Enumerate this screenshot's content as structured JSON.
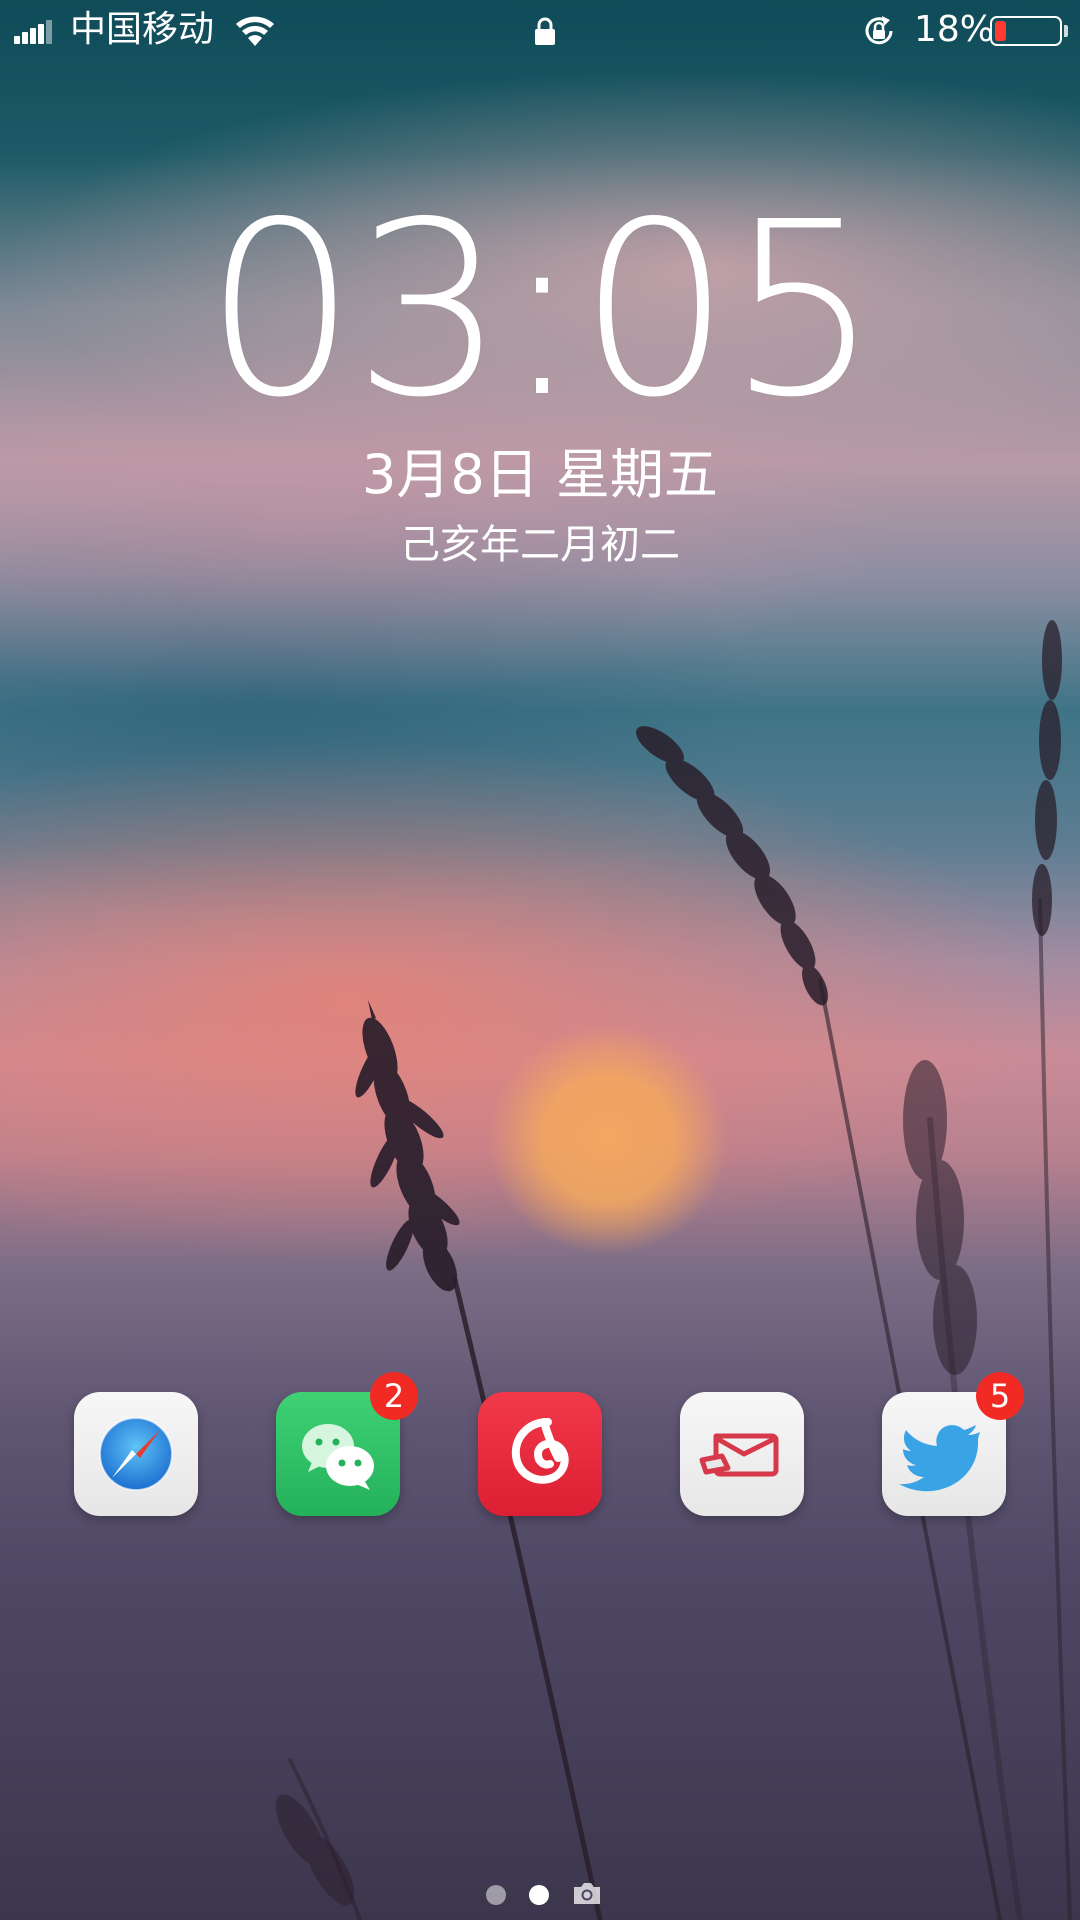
{
  "status_bar": {
    "carrier": "中国移动",
    "battery_percent_label": "18%",
    "battery_level": 0.18,
    "battery_color": "#ff3b30",
    "icons": [
      "signal-icon",
      "wifi-icon",
      "lock-icon",
      "rotation-lock-icon",
      "battery-icon"
    ]
  },
  "lock_screen": {
    "time": "03:05",
    "date": "3月8日 星期五",
    "lunar_date": "己亥年二月初二"
  },
  "dock": {
    "apps": [
      {
        "name": "safari",
        "icon": "safari-compass-icon",
        "badge": ""
      },
      {
        "name": "wechat",
        "icon": "wechat-icon",
        "badge": "2",
        "color": "#2dbd62"
      },
      {
        "name": "netease-music",
        "icon": "netease-music-icon",
        "badge": "",
        "color": "#e8283a"
      },
      {
        "name": "mail",
        "icon": "envelope-icon",
        "badge": "",
        "color": "#d63a4a"
      },
      {
        "name": "twitter",
        "icon": "twitter-bird-icon",
        "badge": "5",
        "color": "#3aa3e6"
      }
    ],
    "badge_color": "#f22a24"
  },
  "page_indicator": {
    "pages": 2,
    "current": 2,
    "trailing_icon": "camera-icon"
  }
}
